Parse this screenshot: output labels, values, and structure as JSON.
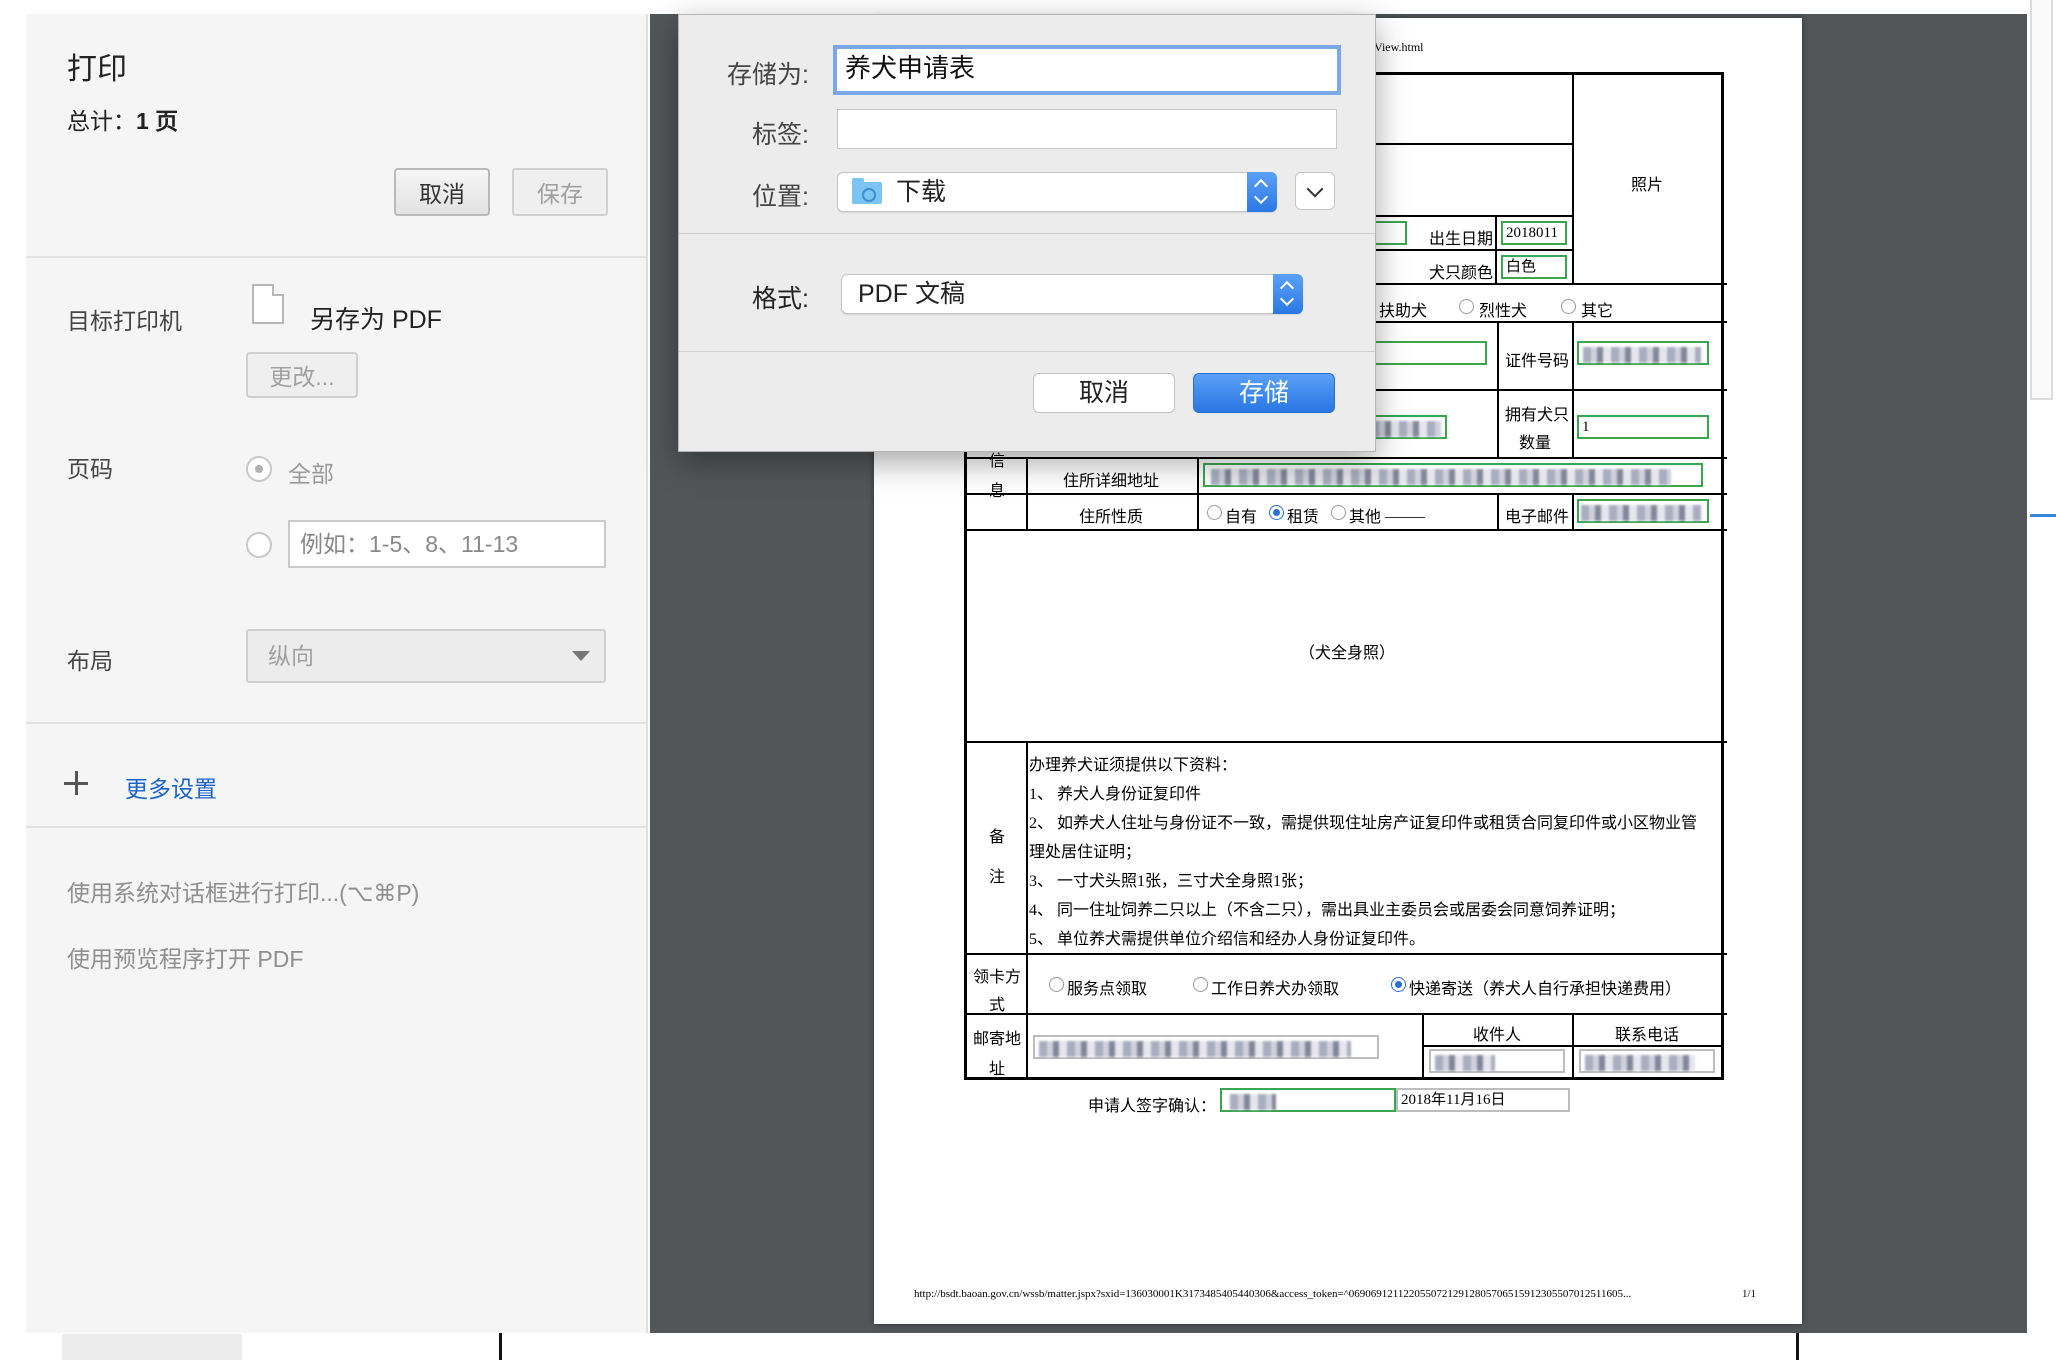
{
  "print_panel": {
    "title": "打印",
    "total_label": "总计：",
    "total_value": "1 页",
    "cancel_label": "取消",
    "save_label": "保存",
    "destination_label": "目标打印机",
    "printer_name": "另存为 PDF",
    "change_label": "更改...",
    "pages_label": "页码",
    "pages_all": "全部",
    "pages_placeholder": "例如：1-5、8、11-13",
    "layout_label": "布局",
    "layout_value": "纵向",
    "more_settings": "更多设置",
    "system_dialog": "使用系统对话框进行打印...(⌥⌘P)",
    "open_preview": "使用预览程序打开 PDF"
  },
  "save_dialog": {
    "save_as_label": "存储为:",
    "save_as_value": "养犬申请表",
    "tags_label": "标签:",
    "location_label": "位置:",
    "location_value": "下载",
    "format_label": "格式:",
    "format_value": "PDF 文稿",
    "cancel_label": "取消",
    "save_label": "存储"
  },
  "document": {
    "url_top": "View.html",
    "photo": "照片",
    "birth_date_label": "出生日期",
    "birth_date_value": "2018011",
    "dog_color_label": "犬只颜色",
    "dog_color_value": "白色",
    "dog_type_options": [
      "扶助犬",
      "烈性犬",
      "其它"
    ],
    "id_number_label": "证件号码",
    "owned_dogs_label_1": "拥有犬只",
    "owned_dogs_label_2": "数量",
    "owned_dogs_value": "1",
    "info_label_1": "信",
    "info_label_2": "息",
    "address_label": "住所详细地址",
    "residence_type_label": "住所性质",
    "residence_options": [
      "自有",
      "租赁",
      "其他"
    ],
    "residence_other_blank": "_____",
    "email_label": "电子邮件",
    "dog_photo": "（犬全身照）",
    "notes_label_1": "备",
    "notes_label_2": "注",
    "notes": [
      "办理养犬证须提供以下资料：",
      "1、  养犬人身份证复印件",
      "2、  如养犬人住址与身份证不一致，需提供现住址房产证复印件或租赁合同复印件或小区物业管",
      "理处居住证明；",
      "3、  一寸犬头照1张，三寸犬全身照1张；",
      "4、  同一住址饲养二只以上（不含二只），需出具业主委员会或居委会同意饲养证明；",
      "5、  单位养犬需提供单位介绍信和经办人身份证复印件。"
    ],
    "pickup_label_1": "领卡方",
    "pickup_label_2": "式",
    "pickup_options": [
      "服务点领取",
      "工作日养犬办领取",
      "快递寄送（养犬人自行承担快递费用）"
    ],
    "mail_address_label_1": "邮寄地",
    "mail_address_label_2": "址",
    "recipient_label": "收件人",
    "phone_label": "联系电话",
    "signature_label": "申请人签字确认：",
    "signature_date": "2018年11月16日",
    "footer_url": "http://bsdt.baoan.gov.cn/wssb/matter.jspx?sxid=136030001K3173485405440306&access_token=^06906912112205507212912805706515912305507012511605...",
    "page_number": "1/1"
  },
  "colors": {
    "accent_blue": "#2a77e3",
    "link_blue": "#1a64c8",
    "field_green": "#3aa650",
    "preview_bg": "#525659",
    "panel_bg": "#f5f5f5"
  }
}
